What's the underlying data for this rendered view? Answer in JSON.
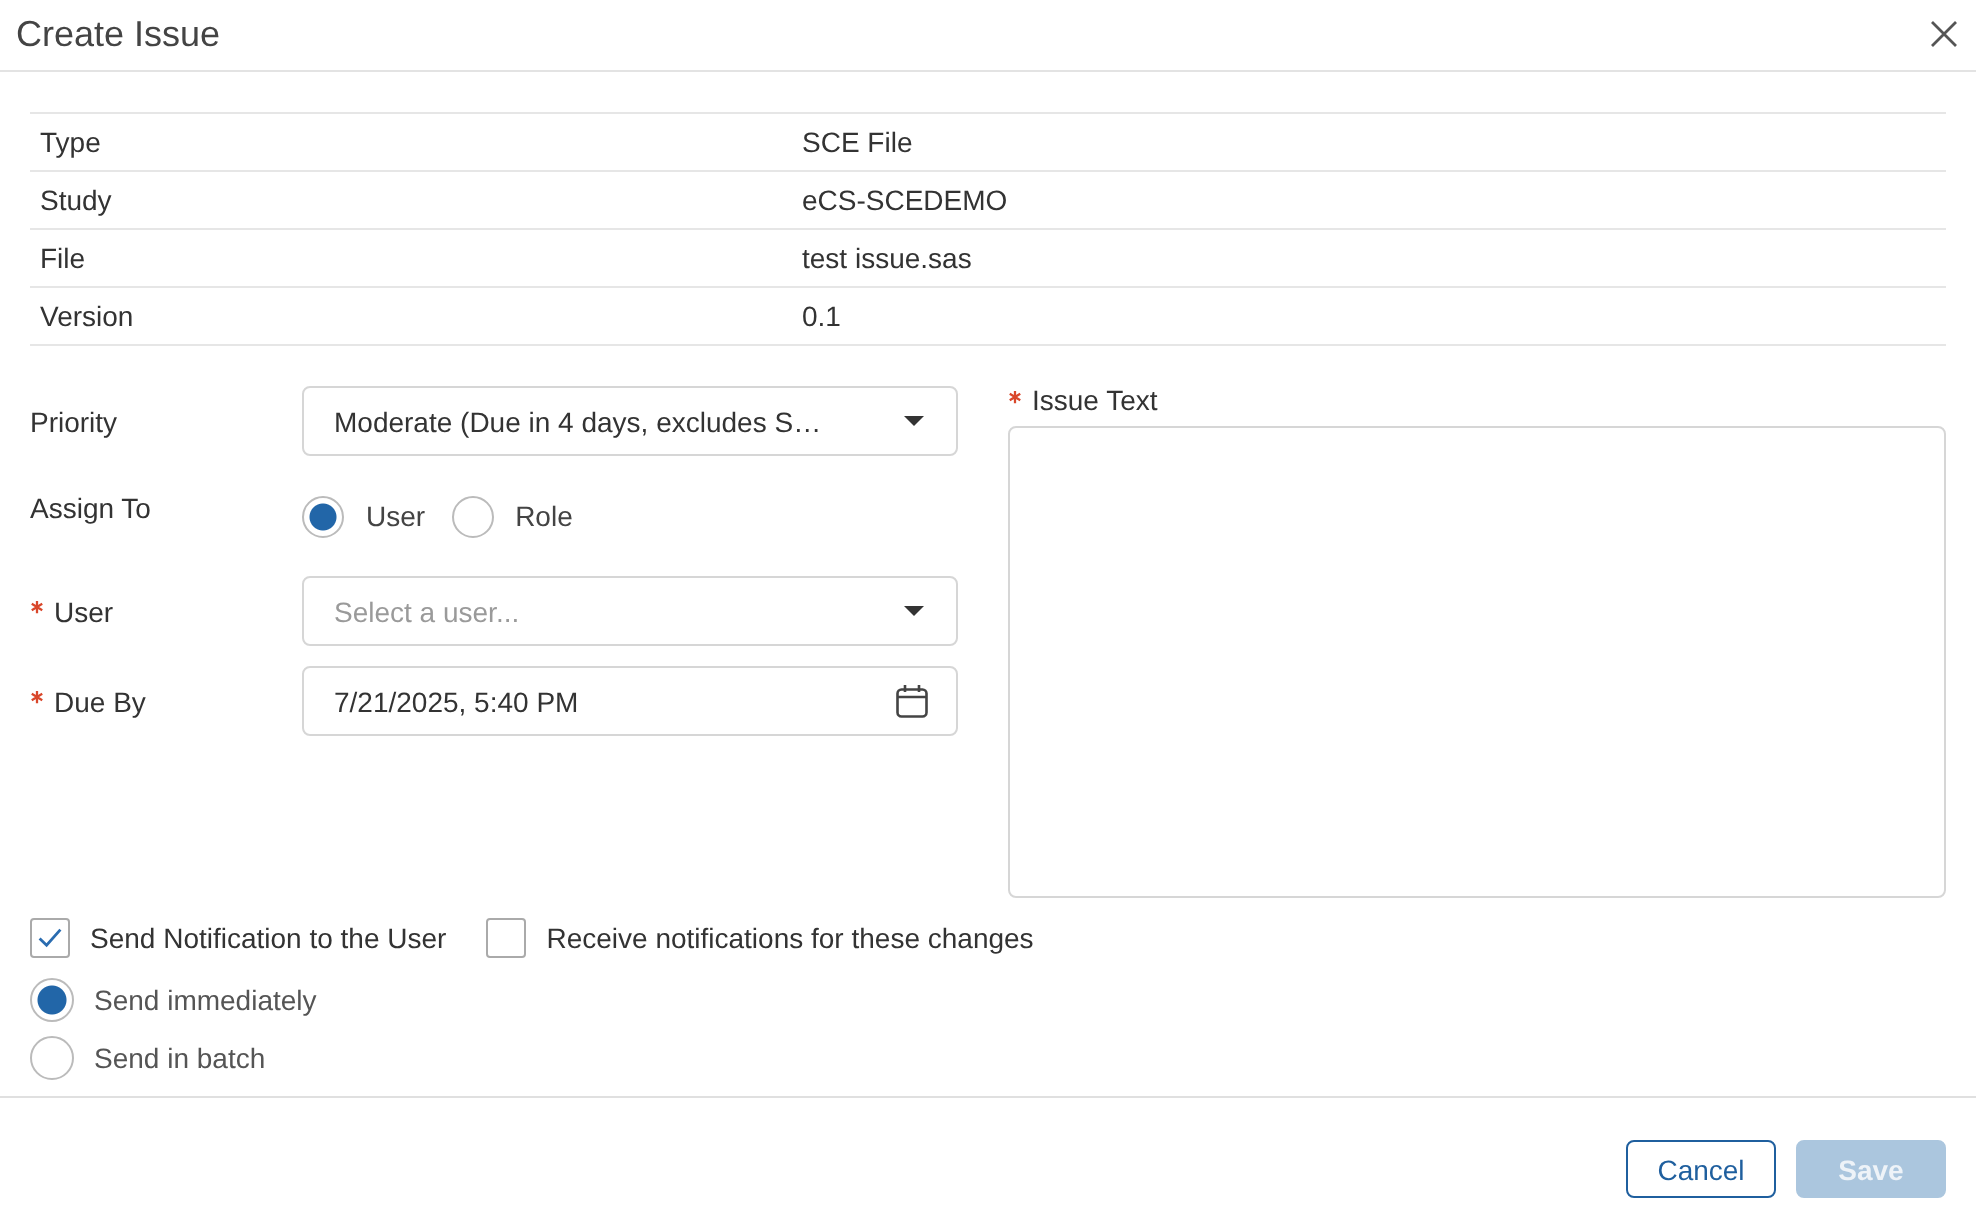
{
  "dialog": {
    "title": "Create Issue"
  },
  "details": [
    {
      "label": "Type",
      "value": "SCE File"
    },
    {
      "label": "Study",
      "value": "eCS-SCEDEMO"
    },
    {
      "label": "File",
      "value": "test issue.sas"
    },
    {
      "label": "Version",
      "value": "0.1"
    }
  ],
  "fields": [
    {
      "kind": "select",
      "label": "Priority",
      "required": false,
      "value": "Moderate (Due in 4 days, excludes S…"
    },
    {
      "kind": "radios",
      "label": "Assign To",
      "required": false,
      "options": [
        {
          "label": "User",
          "selected": true
        },
        {
          "label": "Role",
          "selected": false
        }
      ]
    },
    {
      "kind": "select",
      "label": "User",
      "required": true,
      "placeholder": "Select a user..."
    },
    {
      "kind": "date",
      "label": "Due By",
      "required": true,
      "value": "7/21/2025, 5:40 PM"
    }
  ],
  "issue_text": {
    "label": "Issue Text",
    "required": true
  },
  "notification_options": [
    {
      "label": "Send Notification to the User",
      "checked": true
    },
    {
      "label": "Receive notifications for these changes",
      "checked": false
    }
  ],
  "delivery": [
    {
      "label": "Send immediately",
      "selected": true
    },
    {
      "label": "Send in batch",
      "selected": false
    }
  ],
  "buttons": [
    {
      "label": "Cancel",
      "kind": "secondary",
      "disabled": false
    },
    {
      "label": "Save",
      "kind": "primary",
      "disabled": true
    }
  ]
}
